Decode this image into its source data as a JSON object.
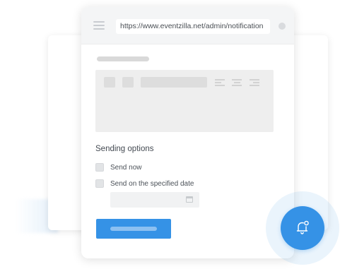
{
  "browser": {
    "url": "https://www.eventzilla.net/admin/notification"
  },
  "form": {
    "section_title": "Sending options",
    "options": [
      {
        "label": "Send now",
        "checked": false
      },
      {
        "label": "Send on the specified date",
        "checked": false
      }
    ],
    "date_value": "",
    "send_button_label": ""
  },
  "icons": {
    "menu": "hamburger-menu-icon",
    "calendar": "calendar-icon",
    "notification": "bell-notification-icon"
  },
  "colors": {
    "accent": "#3592e6",
    "text": "#444a52",
    "skeleton": "#dddddd"
  }
}
